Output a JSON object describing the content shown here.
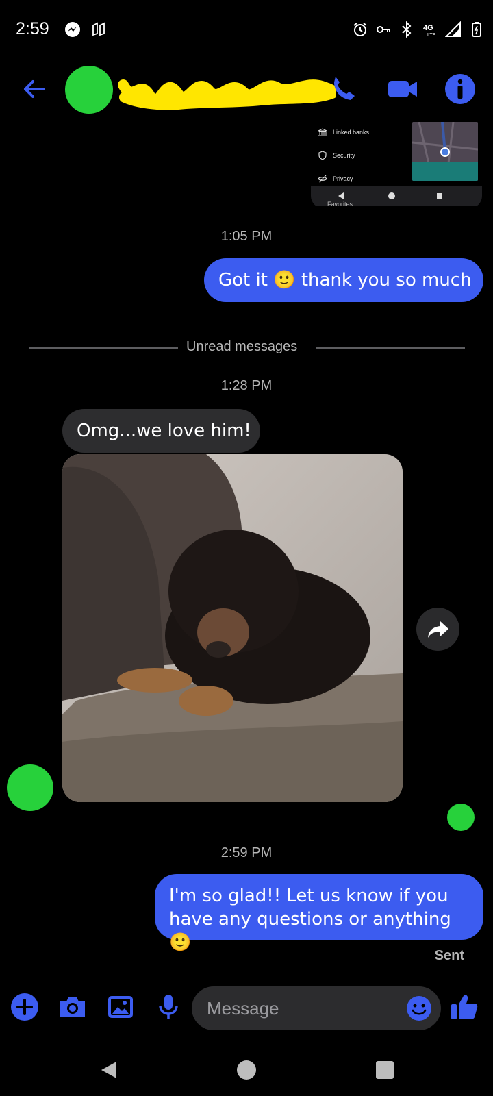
{
  "status_bar": {
    "time": "2:59",
    "network": "4G LTE"
  },
  "header": {
    "contact_name_redacted": true
  },
  "preview": {
    "rows": [
      "Linked banks",
      "Security",
      "Privacy"
    ],
    "favorites": "Favorites"
  },
  "messages": {
    "ts1": "1:05 PM",
    "out1": "Got it 🙂 thank you so much",
    "unread_divider": "Unread messages",
    "ts2": "1:28 PM",
    "in1": "Omg...we love him!",
    "ts3": "2:59 PM",
    "out2": "I'm so glad!! Let us know if you have any questions or anything 🙂",
    "status": "Sent"
  },
  "composer": {
    "placeholder": "Message"
  },
  "colors": {
    "accent": "#3c5cf0",
    "avatar": "#27d13b",
    "scribble": "#ffe600"
  }
}
